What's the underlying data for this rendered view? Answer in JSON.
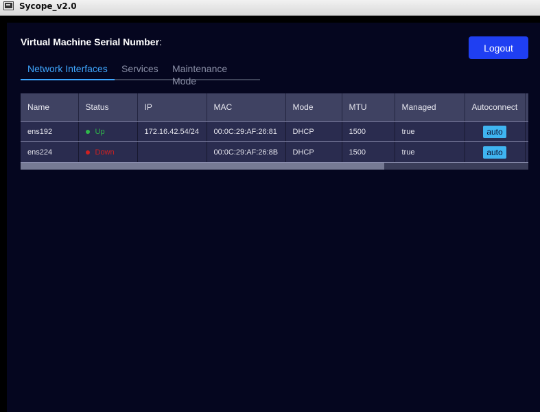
{
  "window": {
    "title": "Sycope_v2.0"
  },
  "header": {
    "vm_label": "Virtual Machine Serial Number",
    "vm_colon": ":",
    "logout_label": "Logout"
  },
  "tabs": [
    {
      "label": "Network Interfaces",
      "active": true
    },
    {
      "label": "Services",
      "active": false
    },
    {
      "label": "Maintenance Mode",
      "active": false
    }
  ],
  "table": {
    "columns": [
      "Name",
      "Status",
      "IP",
      "MAC",
      "Mode",
      "MTU",
      "Managed",
      "Autoconnect"
    ],
    "rows": [
      {
        "name": "ens192",
        "status": "Up",
        "status_color": "#2fb84a",
        "ip": "172.16.42.54/24",
        "mac": "00:0C:29:AF:26:81",
        "mode": "DHCP",
        "mtu": "1500",
        "managed": "true",
        "autoconnect": "auto"
      },
      {
        "name": "ens224",
        "status": "Down",
        "status_color": "#d02020",
        "ip": "",
        "mac": "00:0C:29:AF:26:8B",
        "mode": "DHCP",
        "mtu": "1500",
        "managed": "true",
        "autoconnect": "auto"
      }
    ]
  },
  "colors": {
    "background": "#05061f",
    "accent": "#3fa7ff",
    "logout_button": "#1f3ff2",
    "autoconnect_badge": "#3fb4f0",
    "status_up": "#2fb84a",
    "status_down": "#d02020"
  },
  "icons": {
    "app": "terminal-window-icon",
    "status": "status-dot-icon"
  }
}
